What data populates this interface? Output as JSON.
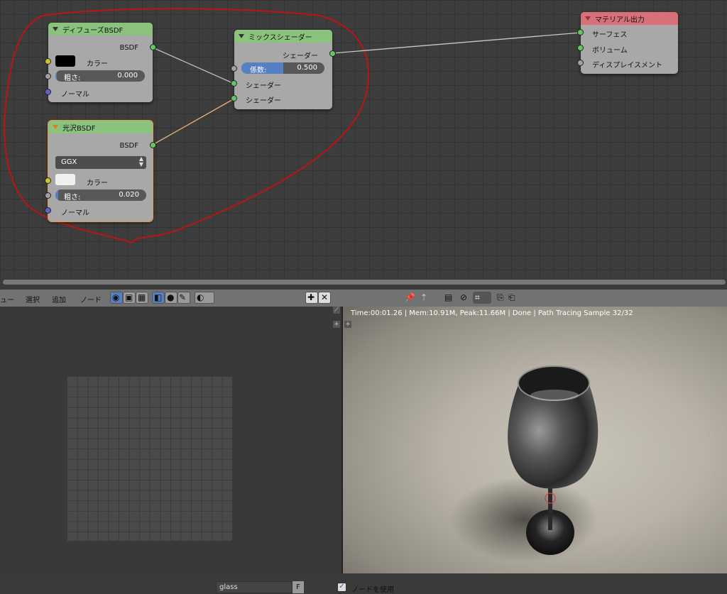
{
  "nodes": {
    "diffuse": {
      "title": "ディフューズBSDF",
      "output": "BSDF",
      "color_label": "カラー",
      "color_value": "#000000",
      "roughness_label": "粗さ:",
      "roughness_value": "0.000",
      "normal_label": "ノーマル"
    },
    "mix": {
      "title": "ミックスシェーダー",
      "output": "シェーダー",
      "factor_label": "係数:",
      "factor_value": "0.500",
      "factor_fraction": 0.5,
      "shader1": "シェーダー",
      "shader2": "シェーダー"
    },
    "material_output": {
      "title": "マテリアル出力",
      "surface": "サーフェス",
      "volume": "ボリューム",
      "displacement": "ディスプレイスメント"
    },
    "glossy": {
      "title": "光沢BSDF",
      "output": "BSDF",
      "distribution": "GGX",
      "color_label": "カラー",
      "color_value": "#f0f0f0",
      "roughness_label": "粗さ:",
      "roughness_value": "0.020",
      "normal_label": "ノーマル"
    }
  },
  "header": {
    "menu_view": "ュー",
    "menu_select": "選択",
    "menu_add": "追加",
    "menu_node": "ノード",
    "material_name": "glass",
    "fake_user": "F",
    "use_nodes_label": "ノードを使用",
    "use_nodes_checked": "✓"
  },
  "viewport": {
    "render_stats": "Time:00:01.26 | Mem:10.91M, Peak:11.66M | Done | Path Tracing Sample 32/32"
  },
  "colors": {
    "node_header_green": "#8bc37e",
    "node_header_red": "#d8707a",
    "annotation_red": "#b01818",
    "slider_blue": "#5680c2"
  }
}
